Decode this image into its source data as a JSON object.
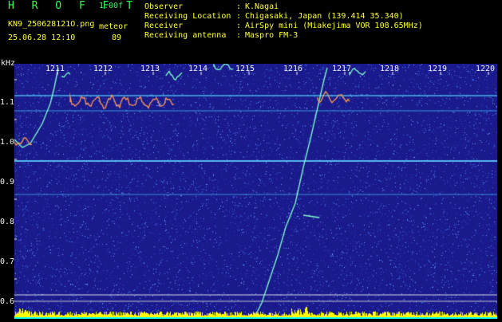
{
  "header": {
    "app_title": "H R O F F T",
    "version": "1.00f",
    "filename": "KN9_250628121O.png",
    "datetime": "25.06.28 12:10",
    "meteor_label": "meteor",
    "meteor_count": "89",
    "info_labels": [
      "Observer",
      "Receiving Location",
      "Receiver",
      "Receiving antenna"
    ],
    "info_seps": [
      ":",
      ":",
      ":",
      ":"
    ],
    "info_values": [
      "K.Nagai",
      "Chigasaki, Japan (139.414 35.340)",
      "AirSpy mini (Miakejima VOR 108.65MHz)",
      "Maspro FM-3"
    ]
  },
  "axis": {
    "unit": "kHz",
    "y_labels": [
      "1.1",
      "1.0",
      "0.9",
      "0.8",
      "0.7",
      "0.6"
    ],
    "x_labels": [
      "1211",
      "1212",
      "1213",
      "1214",
      "1215",
      "1216",
      "1217",
      "1218",
      "1219",
      "1220"
    ]
  },
  "colors": {
    "background": "#1a1a8c",
    "noise_bright": "#4a7bff",
    "carrier": "#5fd6ff",
    "trail": "#7fffc8",
    "signal": "#ff9a55",
    "baseline": "#ffff00",
    "text_yellow": "#ffff33",
    "text_green": "#33ff55"
  }
}
